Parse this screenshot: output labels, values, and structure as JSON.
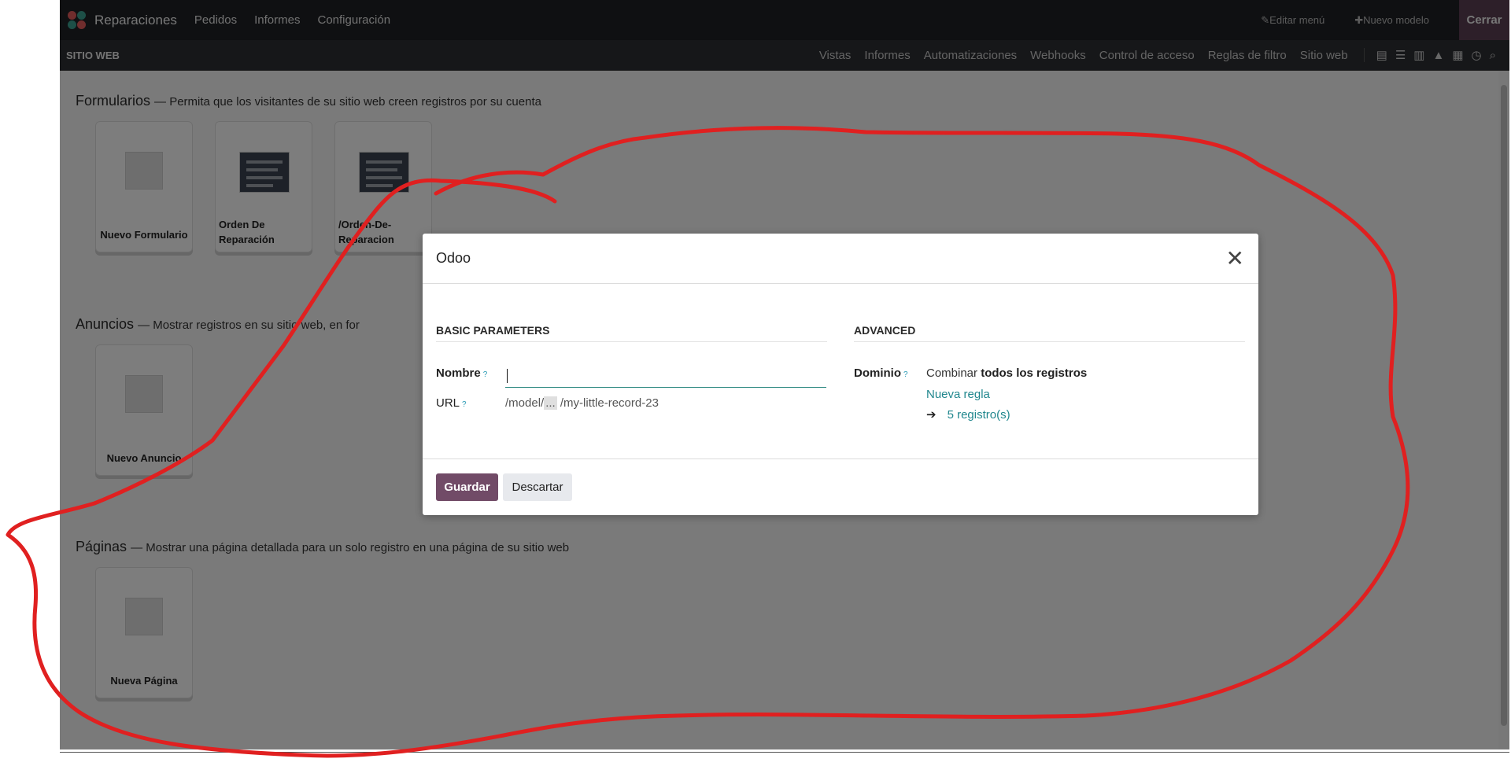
{
  "topbar": {
    "app_name": "Reparaciones",
    "menus": [
      "Pedidos",
      "Informes",
      "Configuración"
    ],
    "edit_menu": "Editar menú",
    "new_model": "Nuevo modelo",
    "close": "Cerrar"
  },
  "subbar": {
    "title": "SITIO WEB",
    "items": [
      "Vistas",
      "Informes",
      "Automatizaciones",
      "Webhooks",
      "Control de acceso",
      "Reglas de filtro",
      "Sitio web"
    ],
    "view_icons": [
      "form-view-icon",
      "list-view-icon",
      "kanban-view-icon",
      "graph-view-icon",
      "pivot-view-icon",
      "activity-view-icon",
      "search-icon"
    ]
  },
  "sections": {
    "forms": {
      "title": "Formularios",
      "desc": "— Permita que los visitantes de su sitio web creen registros por su cuenta",
      "cards": [
        "Nuevo Formulario",
        "Orden De Reparación",
        "/Orden-De-Reparacion"
      ]
    },
    "ads": {
      "title": "Anuncios",
      "desc": "— Mostrar registros en su sitio web, en for",
      "cards": [
        "Nuevo Anuncio"
      ]
    },
    "pages": {
      "title": "Páginas",
      "desc": "— Mostrar una página detallada para un solo registro en una página de su sitio web",
      "cards": [
        "Nueva Página"
      ]
    }
  },
  "dialog": {
    "title": "Odoo",
    "basic_heading": "BASIC PARAMETERS",
    "advanced_heading": "ADVANCED",
    "name_label": "Nombre",
    "name_value": "",
    "url_label": "URL",
    "url_prefix": "/model/",
    "url_dots": "...",
    "url_suffix": " /my-little-record-23",
    "domain_label": "Dominio",
    "domain_prefix": "Combinar ",
    "domain_bold": "todos los registros",
    "new_rule": "Nueva regla",
    "records": "5 registro(s)",
    "help_mark": "?",
    "save": "Guardar",
    "discard": "Descartar"
  },
  "colors": {
    "primary": "#714b67",
    "link": "#21878e",
    "annotation": "#e02020"
  }
}
